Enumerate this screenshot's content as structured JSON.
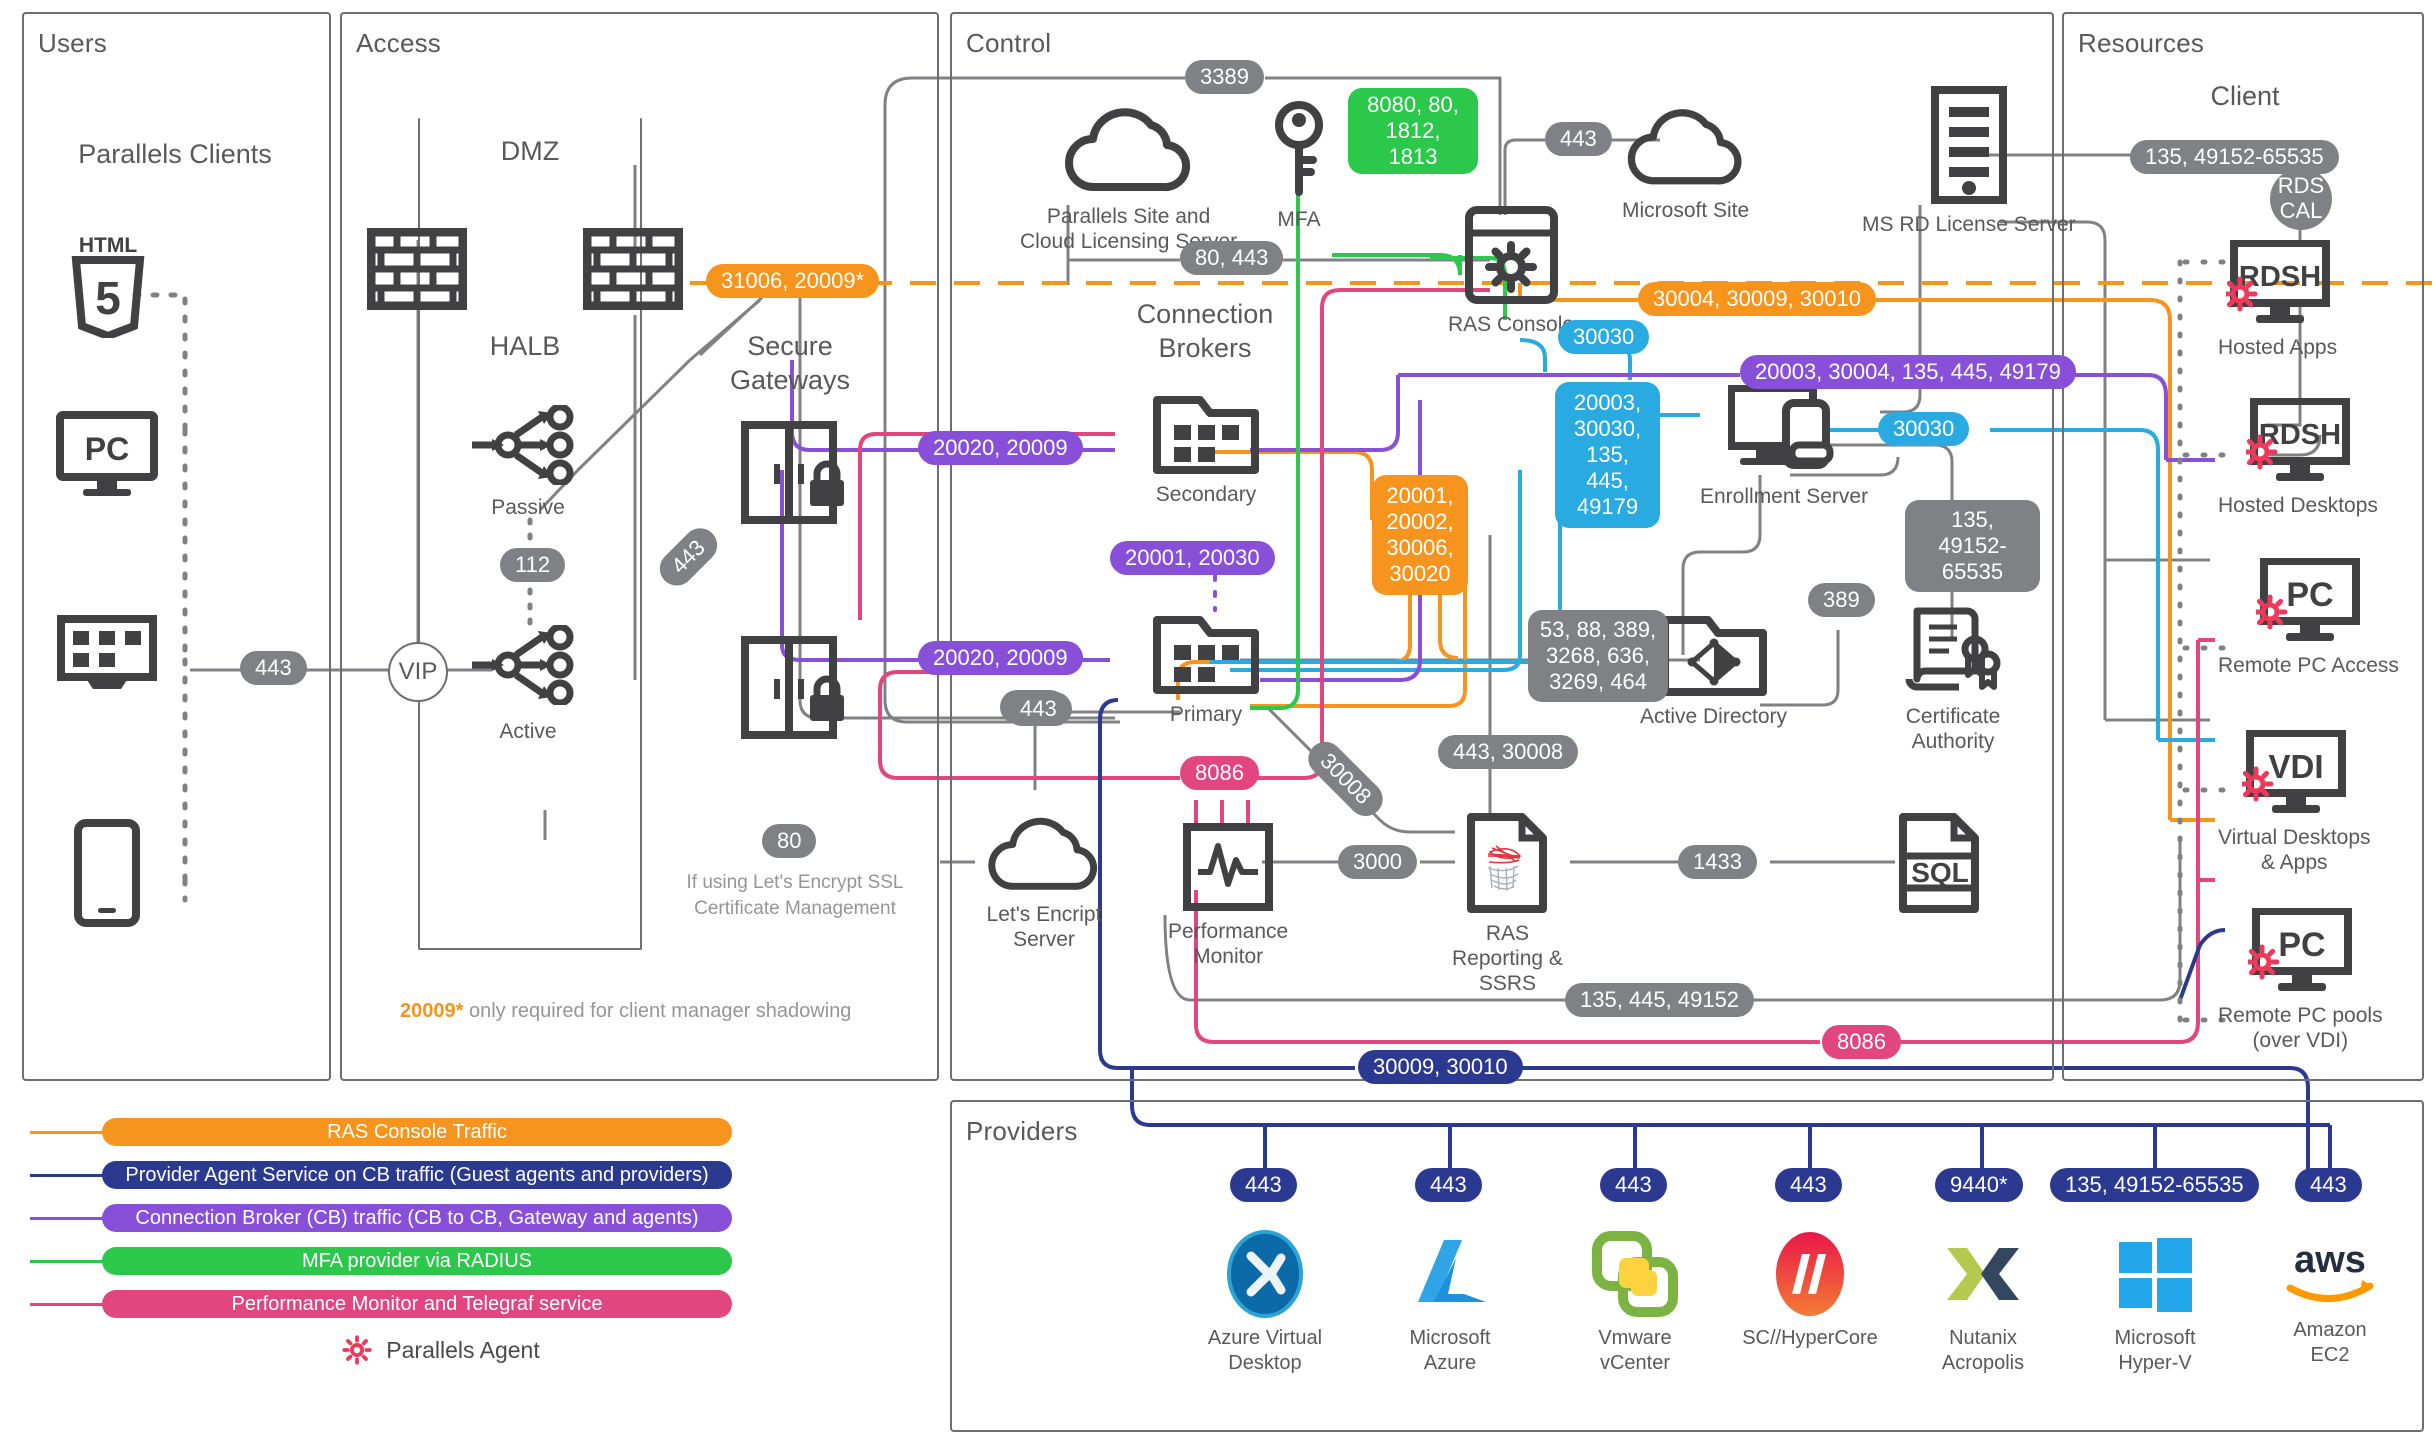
{
  "zones": {
    "users": "Users",
    "access": "Access",
    "control": "Control",
    "resources": "Resources",
    "providers": "Providers"
  },
  "labels": {
    "parallels_clients": "Parallels Clients",
    "dmz": "DMZ",
    "halb": "HALB",
    "passive": "Passive",
    "active": "Active",
    "vip": "VIP",
    "secure_gateways": "Secure\nGateways",
    "connection_brokers": "Connection\nBrokers",
    "secondary": "Secondary",
    "primary": "Primary",
    "client": "Client",
    "rds_cal": "RDS\nCAL"
  },
  "nodes": {
    "parallels_site": "Parallels Site and\nCloud Licensing Server",
    "mfa": "MFA",
    "microsoft_site": "Microsoft Site",
    "ms_rd_license": "MS RD License Server",
    "ras_console": "RAS Console",
    "enrollment_server": "Enrollment Server",
    "active_directory": "Active Directory",
    "certificate_authority": "Certificate\nAuthority",
    "lets_encrypt": "Let's Encript\nServer",
    "performance_monitor": "Performance\nMonitor",
    "ras_reporting": "RAS\nReporting &\nSSRS",
    "sql": "SQL",
    "hosted_apps": "Hosted Apps",
    "hosted_desktops": "Hosted Desktops",
    "remote_pc_access": "Remote PC Access",
    "virtual_desktops": "Virtual Desktops\n& Apps",
    "remote_pc_pools": "Remote PC pools\n(over VDI)",
    "rdsh": "RDSH",
    "pc": "PC",
    "vdi": "VDI",
    "html5": "HTML5"
  },
  "ports": {
    "halb_112": "112",
    "vip_443": "443",
    "gw_443": "443",
    "gw2_443": "443",
    "fw_31006": "31006, 20009*",
    "site_3389": "3389",
    "mfa_8080": "8080, 80,\n1812, 1813",
    "mssite_443": "443",
    "cb_80_443": "80, 443",
    "client_135_49152": "135, 49152-65535",
    "console_30004": "30004, 30009, 30010",
    "console_30030": "30030",
    "es_20003_purple": "20003, 30004, 135, 445, 49179",
    "es_blue_multi": "20003,\n30030,\n135, 445,\n49179",
    "es_30030": "30030",
    "ca_135": "135,\n49152-65535",
    "cb_20020a": "20020, 20009",
    "cb_20020b": "20020, 20009",
    "cb_20001_20030": "20001, 20030",
    "orange_multi": "20001,\n20002,\n30006,\n30020",
    "ad_multi": "53, 88, 389,\n3268, 636,\n3269, 464",
    "ad_389": "389",
    "le_443": "443",
    "le_80": "80",
    "pm_8086": "8086",
    "pm_3000": "3000",
    "ssrs_443_30008": "443, 30008",
    "cb_30008": "30008",
    "sql_1433": "1433",
    "bottom_135_445": "135, 445, 49152",
    "bottom_8086": "8086",
    "bottom_30009": "30009, 30010"
  },
  "notes": {
    "lets_encrypt_note": "If using Let's Encrypt SSL\nCertificate Management",
    "footnote_port": "20009*",
    "footnote_text": "only required for client manager shadowing"
  },
  "legend": {
    "items": [
      {
        "label": "RAS Console Traffic",
        "color": "#f7941e"
      },
      {
        "label": "Provider Agent Service on CB traffic (Guest agents and providers)",
        "color": "#2b3990"
      },
      {
        "label": "Connection Broker (CB) traffic (CB to CB, Gateway and agents)",
        "color": "#8850d8"
      },
      {
        "label": "MFA provider via RADIUS",
        "color": "#2bc84b"
      },
      {
        "label": "Performance Monitor and Telegraf service",
        "color": "#e2467e"
      }
    ],
    "agent_label": "Parallels Agent",
    "agent_color": "#ee3a5a"
  },
  "providers": [
    {
      "name": "Azure Virtual\nDesktop",
      "port": "443",
      "icon": "avd-icon"
    },
    {
      "name": "Microsoft\nAzure",
      "port": "443",
      "icon": "azure-icon"
    },
    {
      "name": "Vmware\nvCenter",
      "port": "443",
      "icon": "vmware-icon"
    },
    {
      "name": "SC//HyperCore",
      "port": "443",
      "icon": "hypercore-icon"
    },
    {
      "name": "Nutanix\nAcropolis",
      "port": "9440*",
      "icon": "nutanix-icon"
    },
    {
      "name": "Microsoft\nHyper-V",
      "port": "135, 49152-65535",
      "icon": "hyperv-icon"
    },
    {
      "name": "Amazon\nEC2",
      "port": "443",
      "icon": "aws-icon"
    }
  ],
  "colors": {
    "orange": "#f7941e",
    "blue": "#2b3990",
    "purple": "#8850d8",
    "green": "#2bc84b",
    "pink": "#e2467e",
    "cyan": "#29abe2",
    "grey": "#808184",
    "dark": "#414042",
    "agent_red": "#ee3a5a"
  }
}
